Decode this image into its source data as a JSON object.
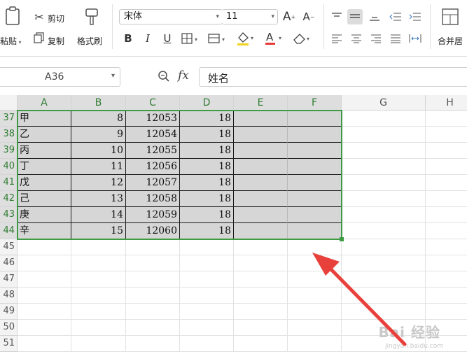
{
  "ribbon": {
    "cut": "剪切",
    "paste": "粘贴",
    "copy": "复制",
    "format_painter": "格式刷",
    "font_name": "宋体",
    "font_size": "11",
    "bold": "B",
    "italic": "I",
    "underline": "U",
    "merge_center": "合并居"
  },
  "formula_bar": {
    "name_box": "A36",
    "fx": "fx",
    "formula": "姓名"
  },
  "columns": [
    "A",
    "B",
    "C",
    "D",
    "E",
    "F",
    "G",
    "H"
  ],
  "rows": [
    {
      "num": "37",
      "a": "甲",
      "b": "8",
      "c": "12053",
      "d": "18"
    },
    {
      "num": "38",
      "a": "乙",
      "b": "9",
      "c": "12054",
      "d": "18"
    },
    {
      "num": "39",
      "a": "丙",
      "b": "10",
      "c": "12055",
      "d": "18"
    },
    {
      "num": "40",
      "a": "丁",
      "b": "11",
      "c": "12056",
      "d": "18"
    },
    {
      "num": "41",
      "a": "戊",
      "b": "12",
      "c": "12057",
      "d": "18"
    },
    {
      "num": "42",
      "a": "己",
      "b": "13",
      "c": "12058",
      "d": "18"
    },
    {
      "num": "43",
      "a": "庚",
      "b": "14",
      "c": "12059",
      "d": "18"
    },
    {
      "num": "44",
      "a": "辛",
      "b": "15",
      "c": "12060",
      "d": "18"
    }
  ],
  "empty_rows": [
    "45",
    "46",
    "47",
    "48",
    "49",
    "50",
    "51"
  ],
  "watermark": {
    "text": "Bai 经验",
    "sub": "jingyan.baidu.com"
  },
  "colors": {
    "selection_border": "#3f9b44",
    "selection_fill": "#d6d6d6",
    "annotation_arrow": "#e8413b"
  }
}
